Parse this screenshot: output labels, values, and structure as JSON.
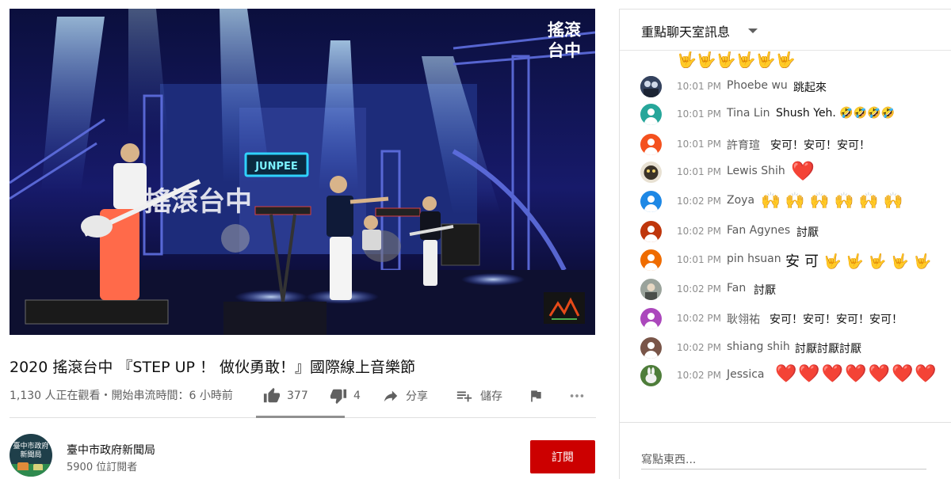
{
  "video": {
    "logo_line1": "搖滾",
    "logo_line2": "台中",
    "stage_banner": "搖滾台中",
    "stage_sign": "JUNPEE"
  },
  "title": "2020 搖滾台中 『STEP UP ！ 做伙勇敢！』國際線上音樂節",
  "meta": {
    "viewers_text": "1,130 人正在觀看・開始串流時間：6 小時前",
    "like_count": "377",
    "dislike_count": "4",
    "share_label": "分享",
    "save_label": "儲存"
  },
  "channel": {
    "name": "臺中市政府新聞局",
    "subscribers": "5900 位訂閱者",
    "avatar_text_line1": "臺中市政府",
    "avatar_text_line2": "新聞局",
    "subscribe_label": "訂閱"
  },
  "chat": {
    "header": "重點聊天室訊息",
    "input_placeholder": "寫點東西...",
    "partial_top_emojis": "🤟🤟🤟🤟🤟🤟",
    "messages": [
      {
        "time": "10:01 PM",
        "author": "Phoebe wu",
        "text": "跳起來",
        "avatar": "photo-dark"
      },
      {
        "time": "10:01 PM",
        "author": "Tina Lin",
        "text": "Shush Yeh. 🤣🤣🤣🤣",
        "avatar": "teal"
      },
      {
        "time": "10:01 PM",
        "author": "許育瑄",
        "text": "安可！安可！安可！",
        "avatar": "orange"
      },
      {
        "time": "10:01 PM",
        "author": "Lewis Shih",
        "text": "❤️",
        "avatar": "photo-cat"
      },
      {
        "time": "10:02 PM",
        "author": "Zoya",
        "text": "🙌🙌🙌🙌🙌🙌",
        "avatar": "blue"
      },
      {
        "time": "10:02 PM",
        "author": "Fan Agynes",
        "text": "討厭",
        "avatar": "brick"
      },
      {
        "time": "10:01 PM",
        "author": "pin hsuan",
        "text": "安可🤟🤟🤟🤟🤟",
        "avatar": "orange2"
      },
      {
        "time": "10:02 PM",
        "author": "Fan",
        "text": "討厭",
        "avatar": "photo-gray"
      },
      {
        "time": "10:02 PM",
        "author": "耿翎祐",
        "text": "安可！安可！安可！安可！",
        "avatar": "purple"
      },
      {
        "time": "10:02 PM",
        "author": "shiang shih",
        "text": "討厭討厭討厭",
        "avatar": "brown"
      },
      {
        "time": "10:02 PM",
        "author": "Jessica",
        "text": "❤️❤️❤️❤️❤️❤️❤️",
        "avatar": "photo-rabbit"
      }
    ]
  },
  "colors": {
    "subscribe_red": "#cc0000",
    "heart_red": "#e0191d",
    "emoji_yellow": "#f4b400",
    "secondary_text": "#606060"
  },
  "icons": [
    "like-icon",
    "dislike-icon",
    "share-icon",
    "save-playlist-icon",
    "flag-icon",
    "more-icon",
    "chat-dropdown-caret-icon"
  ]
}
